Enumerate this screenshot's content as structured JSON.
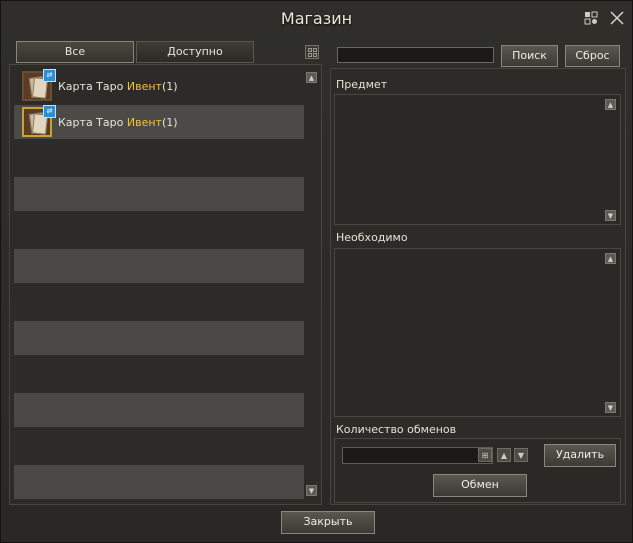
{
  "window": {
    "title": "Магазин"
  },
  "tabs": [
    {
      "label": "Все"
    },
    {
      "label": "Доступно"
    }
  ],
  "items": [
    {
      "name": "Карта Таро ",
      "tag": "Ивент",
      "count": "(1)"
    },
    {
      "name": "Карта Таро ",
      "tag": "Ивент",
      "count": "(1)"
    }
  ],
  "search": {
    "value": "",
    "search_label": "Поиск",
    "reset_label": "Сброс"
  },
  "sections": {
    "item": "Предмет",
    "required": "Необходимо",
    "exchange_count": "Количество обменов"
  },
  "buttons": {
    "delete": "Удалить",
    "exchange": "Обмен",
    "close": "Закрыть"
  },
  "colors": {
    "event_tag": "#f0c23a",
    "background": "#2c2b27"
  },
  "icons": {
    "settings": "gear-puzzle-icon",
    "close": "close-icon",
    "grid": "grid-view-icon"
  }
}
